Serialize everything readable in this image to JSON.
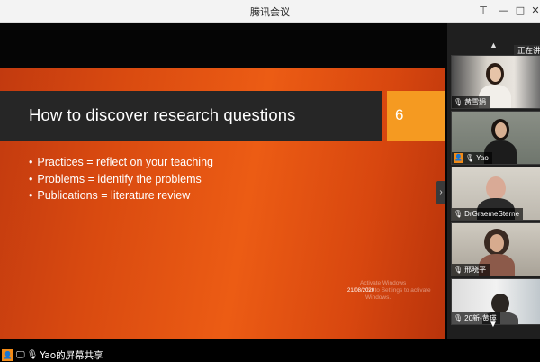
{
  "window": {
    "title": "腾讯会议",
    "buttons": {
      "pin": "⊤",
      "minimize": "—",
      "maximize": "□",
      "close": "✕"
    }
  },
  "slide": {
    "title": "How to discover research questions",
    "number": "6",
    "bullets": [
      "Practices = reflect on your teaching",
      "Problems = identify the problems",
      "Publications = literature review"
    ],
    "watermark_line1": "Activate Windows",
    "watermark_line2": "Go to Settings to activate Windows.",
    "date": "21/08/2020"
  },
  "sidebar": {
    "speaking_label": "正在讲话",
    "participants": [
      {
        "name": "黄雪娟",
        "mic": "mic-muted-icon",
        "host": false
      },
      {
        "name": "Yao",
        "mic": "mic-icon",
        "host": true
      },
      {
        "name": "DrGraemeSterne",
        "mic": "mic-icon",
        "host": false
      },
      {
        "name": "邢晓平",
        "mic": "mic-icon",
        "host": false
      },
      {
        "name": "20新-黄瑛",
        "mic": "mic-muted-icon",
        "host": false
      }
    ]
  },
  "bottom": {
    "share_text": "Yao的屏幕共享"
  },
  "colors": {
    "slide_orange": "#e2520f",
    "slide_number_box": "#f59a21",
    "slide_title_bar": "#262626",
    "host_badge": "#f28b18"
  }
}
